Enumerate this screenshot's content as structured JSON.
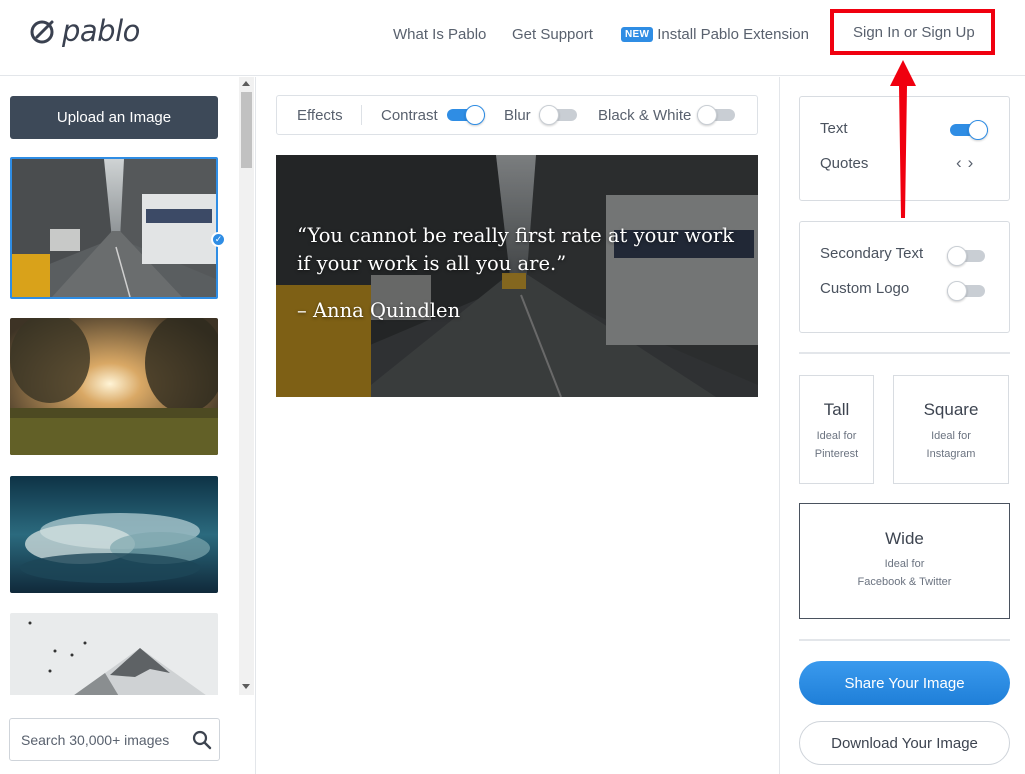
{
  "app": {
    "logo_text": "pablo"
  },
  "nav": {
    "what_is": "What Is Pablo",
    "support": "Get Support",
    "new_badge": "NEW",
    "install": "Install Pablo Extension",
    "signin": "Sign In or Sign Up"
  },
  "sidebar": {
    "upload_label": "Upload an Image",
    "search_placeholder": "Search 30,000+ images",
    "thumbnails": [
      {
        "name": "city-street",
        "selected": true
      },
      {
        "name": "sunset-grass",
        "selected": false
      },
      {
        "name": "clouds-sky",
        "selected": false
      },
      {
        "name": "snowy-mountain",
        "selected": false
      }
    ]
  },
  "effects": {
    "label": "Effects",
    "contrast": {
      "label": "Contrast",
      "on": true
    },
    "blur": {
      "label": "Blur",
      "on": false
    },
    "black_white": {
      "label": "Black & White",
      "on": false
    }
  },
  "canvas": {
    "quote": "“You cannot be really first rate at your work if your work is all you are.”",
    "author": "– Anna Quindlen"
  },
  "right_panel": {
    "text": {
      "label": "Text",
      "on": true
    },
    "quotes": {
      "label": "Quotes"
    },
    "secondary_text": {
      "label": "Secondary Text",
      "on": false
    },
    "custom_logo": {
      "label": "Custom Logo",
      "on": false
    },
    "sizes": {
      "tall": {
        "title": "Tall",
        "desc_1": "Ideal for",
        "desc_2": "Pinterest"
      },
      "square": {
        "title": "Square",
        "desc_1": "Ideal for",
        "desc_2": "Instagram"
      },
      "wide": {
        "title": "Wide",
        "desc_1": "Ideal for",
        "desc_2": "Facebook & Twitter"
      }
    },
    "share_label": "Share Your Image",
    "download_label": "Download Your Image"
  },
  "colors": {
    "accent": "#2f8de4",
    "dark_button": "#3d4958",
    "highlight": "#f0000f"
  }
}
